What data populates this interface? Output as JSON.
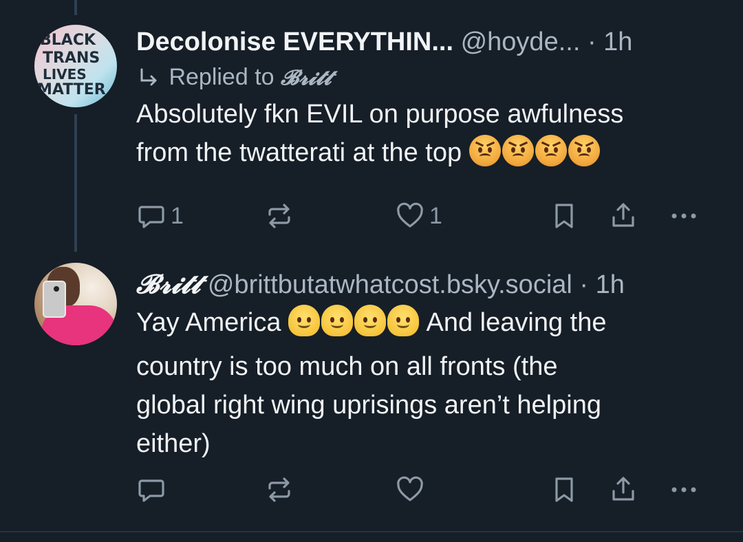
{
  "colors": {
    "background": "#161e27",
    "text_primary": "#f1f3f5",
    "text_secondary": "#aab6c3",
    "icon": "#8c99a6",
    "thread_line": "#2e4052"
  },
  "posts": [
    {
      "avatar": {
        "icon": "sign-avatar",
        "words": [
          "BLACK",
          "TRANS",
          "LIVES",
          "MATTER"
        ]
      },
      "display_name": "Decolonise EVERYTHIN...",
      "handle": "@hoyde...",
      "separator": "·",
      "time": "1h",
      "reply_prefix": "Replied to",
      "reply_to": "𝓑𝓻𝓲𝓽𝓽",
      "text_line1": "Absolutely fkn EVIL on purpose awfulness",
      "text_line2": "from the twatterati at the top",
      "emojis": [
        "angry-face",
        "angry-face",
        "angry-face",
        "angry-face"
      ],
      "reply_count": "1",
      "repost_count": "",
      "like_count": "1"
    },
    {
      "avatar": {
        "icon": "photo-avatar"
      },
      "display_name": "𝓑𝓻𝓲𝓽𝓽",
      "handle": "@brittbutatwhatcost.bsky.social",
      "separator": "·",
      "time": "1h",
      "text_before_emojis": "Yay America",
      "emojis": [
        "melting-face",
        "melting-face",
        "melting-face",
        "melting-face"
      ],
      "text_after_emojis": "And leaving the",
      "text_line2": "country is too much on all fronts (the",
      "text_line3": "global right wing uprisings aren’t helping",
      "text_line4": "either)",
      "reply_count": "",
      "repost_count": "",
      "like_count": ""
    }
  ],
  "action_icons": [
    "reply-icon",
    "repost-icon",
    "like-icon",
    "bookmark-icon",
    "share-icon",
    "more-icon"
  ]
}
